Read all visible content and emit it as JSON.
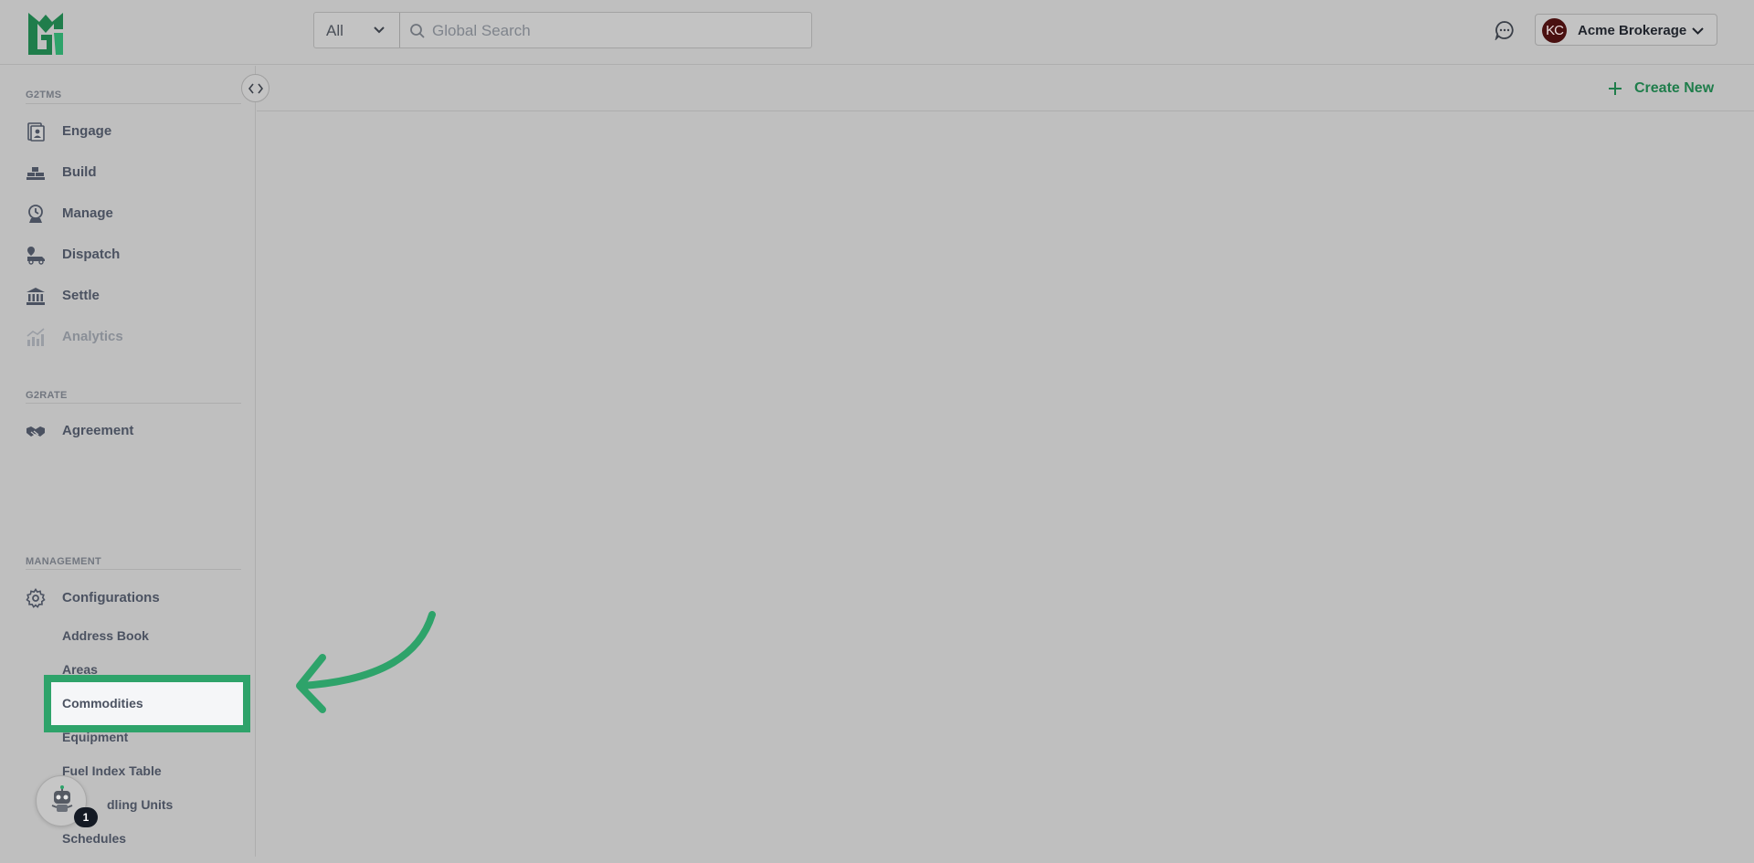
{
  "colors": {
    "accent": "#2ea36a",
    "brand": "#1f7d4b",
    "background": "#bfbfbf",
    "avatar_bg": "#4a1010"
  },
  "header": {
    "logo_icon": "g2-logo-icon",
    "search": {
      "scope": "All",
      "placeholder": "Global Search"
    },
    "chat_icon": "chat-bubble-icon",
    "account": {
      "initials": "KC",
      "name": "Acme Brokerage"
    }
  },
  "sidebar": {
    "sections": [
      {
        "heading": "G2TMS",
        "items": [
          {
            "label": "Engage",
            "icon": "engage-icon"
          },
          {
            "label": "Build",
            "icon": "build-icon"
          },
          {
            "label": "Manage",
            "icon": "manage-icon"
          },
          {
            "label": "Dispatch",
            "icon": "dispatch-truck-icon"
          },
          {
            "label": "Settle",
            "icon": "bank-icon"
          },
          {
            "label": "Analytics",
            "icon": "analytics-chart-icon",
            "disabled": true
          }
        ]
      },
      {
        "heading": "G2RATE",
        "items": [
          {
            "label": "Agreement",
            "icon": "handshake-icon"
          }
        ]
      },
      {
        "heading": "MANAGEMENT",
        "items": [
          {
            "label": "Configurations",
            "icon": "gear-icon"
          }
        ]
      }
    ],
    "config_subitems": [
      "Address Book",
      "Areas",
      "Commodities",
      "Equipment",
      "Fuel Index Table",
      "dling Units",
      "Schedules"
    ],
    "highlighted_item": "Commodities"
  },
  "main": {
    "create_label": "Create New"
  },
  "bot": {
    "badge_count": "1"
  }
}
